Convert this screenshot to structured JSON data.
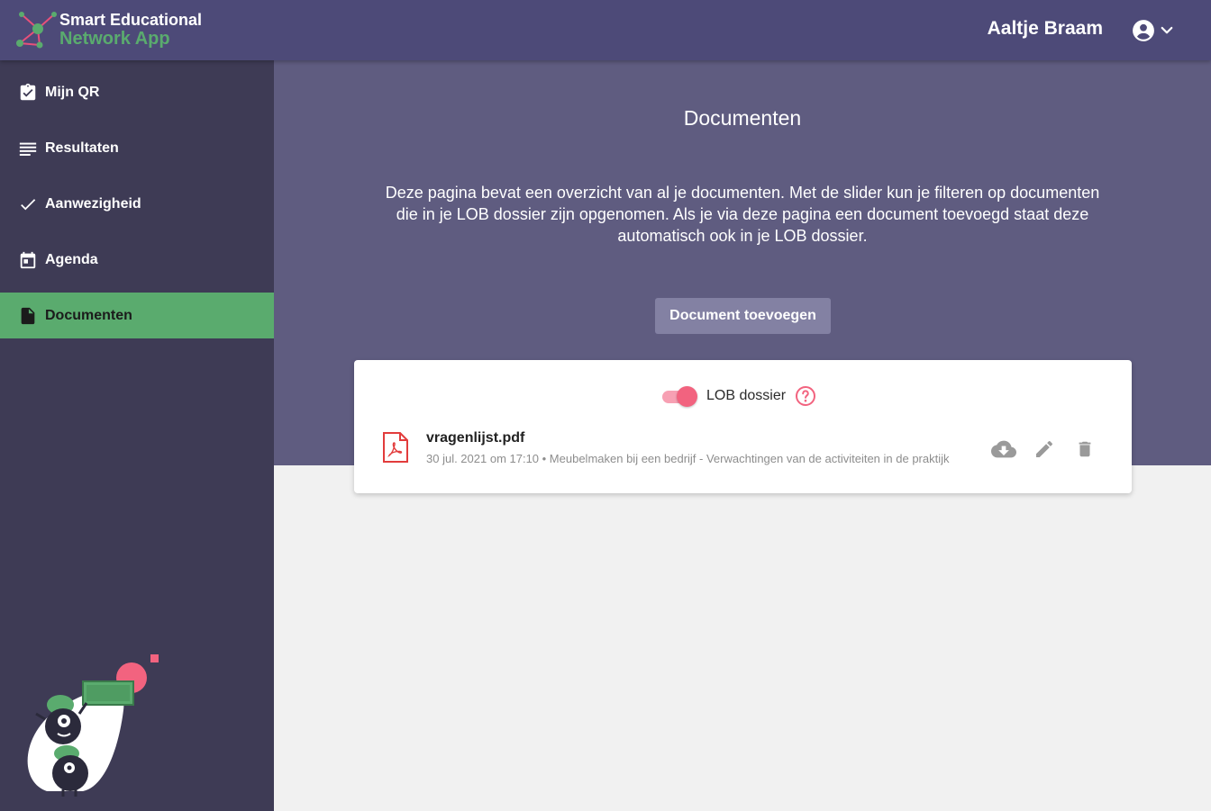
{
  "app": {
    "logo_line1": "Smart Educational",
    "logo_line2": "Network App",
    "brand_green": "#5aab6e",
    "brand_purple": "#4d4a78"
  },
  "header": {
    "username": "Aaltje Braam",
    "account_icon": "account-circle-icon"
  },
  "sidebar": {
    "items": [
      {
        "label": "Mijn QR",
        "icon": "clipboard-check-icon"
      },
      {
        "label": "Resultaten",
        "icon": "list-lines-icon"
      },
      {
        "label": "Aanwezigheid",
        "icon": "checkmark-icon"
      },
      {
        "label": "Agenda",
        "icon": "calendar-icon"
      },
      {
        "label": "Documenten",
        "icon": "document-icon",
        "active": true
      }
    ]
  },
  "main": {
    "title": "Documenten",
    "intro": "Deze pagina bevat een overzicht van al je documenten. Met de slider kun je filteren op documenten die in je LOB dossier zijn opgenomen. Als je via deze pagina een document toevoegd staat deze automatisch ook in je LOB dossier.",
    "add_button": "Document toevoegen",
    "filter": {
      "label": "LOB dossier",
      "enabled": true
    },
    "documents": [
      {
        "name": "vragenlijst.pdf",
        "meta": "30 jul. 2021 om 17:10 • Meubelmaken bij een bedrijf - Verwachtingen van de activiteiten in de praktijk",
        "icon": "pdf-file-icon"
      }
    ]
  }
}
